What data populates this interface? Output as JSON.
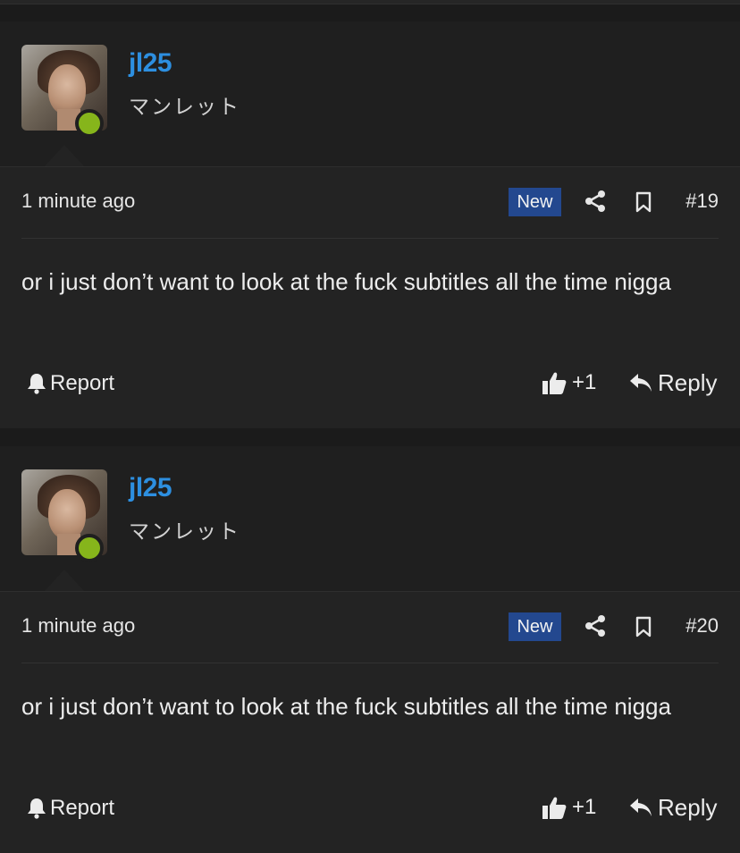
{
  "posts": [
    {
      "username": "jl25",
      "user_title": "マンレット",
      "time": "1 minute ago",
      "badge": "New",
      "post_number": "#19",
      "message": "or i just don’t want to look at the fuck subtitles all the time nigga",
      "report_label": "Report",
      "like_count": "+1",
      "reply_label": "Reply"
    },
    {
      "username": "jl25",
      "user_title": "マンレット",
      "time": "1 minute ago",
      "badge": "New",
      "post_number": "#20",
      "message": "or i just don’t want to look at the fuck subtitles all the time nigga",
      "report_label": "Report",
      "like_count": "+1",
      "reply_label": "Reply"
    }
  ],
  "colors": {
    "username": "#2d8fe0",
    "online": "#86b51b",
    "badge_bg": "#23488f",
    "background": "#1b1b1b"
  },
  "icons": [
    "avatar",
    "online-status-icon",
    "share-icon",
    "bookmark-icon",
    "bell-icon",
    "thumbs-up-icon",
    "reply-icon"
  ]
}
